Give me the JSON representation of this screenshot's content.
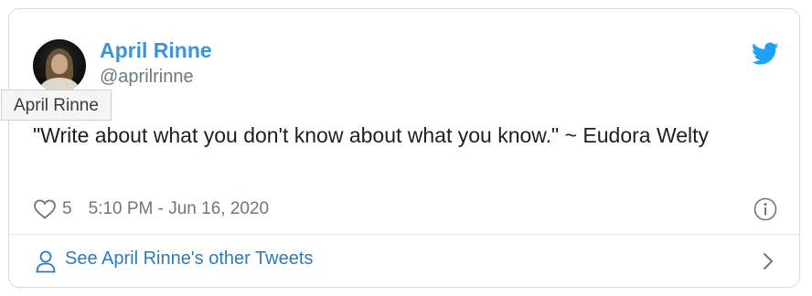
{
  "tweet": {
    "author_name": "April Rinne",
    "author_handle": "@aprilrinne",
    "text": "\"Write about what you don't know about what you know.\" ~ Eudora Welty",
    "like_count": "5",
    "timestamp": "5:10 PM - Jun 16, 2020"
  },
  "tooltip": {
    "text": "April Rinne"
  },
  "footer": {
    "label": "See April Rinne's other Tweets"
  },
  "icons": {
    "brand": "twitter-bird-icon",
    "like": "heart-icon",
    "info": "info-icon",
    "profile": "person-icon",
    "next": "chevron-right-icon"
  },
  "colors": {
    "name": "#3b94d9",
    "link": "#2b7bb9",
    "muted": "#697882",
    "text": "#1c2022",
    "twitter_blue": "#1da1f2"
  }
}
